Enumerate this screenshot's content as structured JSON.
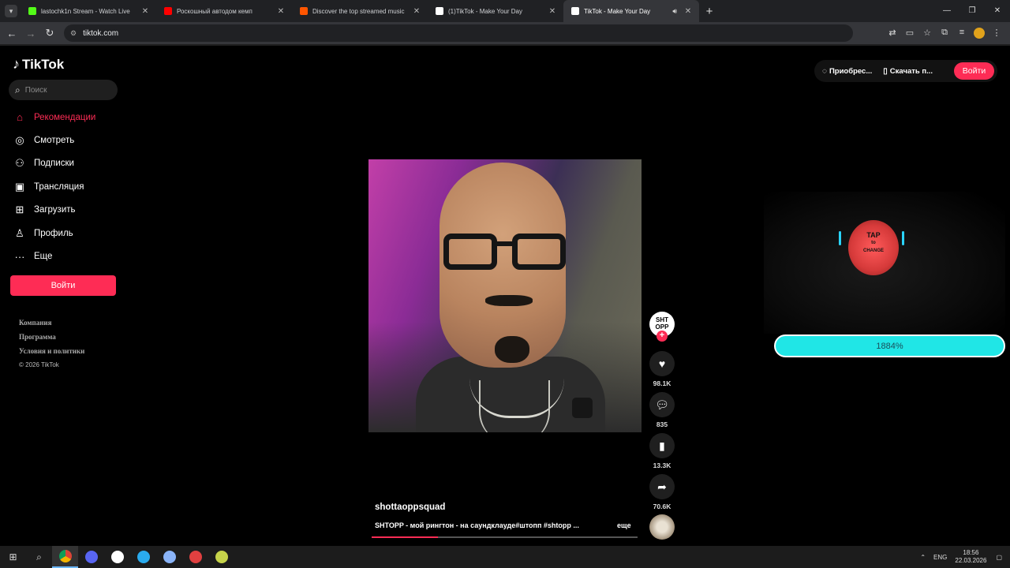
{
  "browser": {
    "tabs": [
      {
        "title": "lastochk1n Stream - Watch Live",
        "favicon_color": "#53fc18"
      },
      {
        "title": "Роскошный автодом кемп",
        "favicon_color": "#ff0000"
      },
      {
        "title": "Discover the top streamed music",
        "favicon_color": "#ff5500"
      },
      {
        "title": "(1)TikTok - Make Your Day",
        "favicon_color": "#ffffff"
      },
      {
        "title": "TikTok - Make Your Day",
        "favicon_color": "#ffffff",
        "active": true
      }
    ],
    "url": "tiktok.com"
  },
  "sidebar": {
    "logo": "TikTok",
    "search_placeholder": "Поиск",
    "nav": [
      {
        "label": "Рекомендации",
        "icon": "home-icon",
        "active": true
      },
      {
        "label": "Смотреть",
        "icon": "compass-icon"
      },
      {
        "label": "Подписки",
        "icon": "following-icon"
      },
      {
        "label": "Трансляция",
        "icon": "live-icon"
      },
      {
        "label": "Загрузить",
        "icon": "upload-icon"
      },
      {
        "label": "Профиль",
        "icon": "profile-icon"
      },
      {
        "label": "Еще",
        "icon": "more-icon"
      }
    ],
    "login_button": "Войти",
    "footer": {
      "company": "Компания",
      "program": "Программа",
      "terms": "Условия и политики",
      "copyright": "© 2026 TikTok"
    }
  },
  "header": {
    "get_coins": "Приобрес...",
    "download_app": "Скачать п...",
    "login": "Войти"
  },
  "video": {
    "creator": "shottaoppsquad",
    "description": "SHTOPP - мой рингтон - на саундклауде#штопп #shtopp ...",
    "more_label": "еще",
    "progress_fraction": 0.25,
    "avatar_text": "SHT OPP",
    "likes": "98.1K",
    "comments": "835",
    "saves": "13.3K",
    "shares": "70.6K"
  },
  "overlay": {
    "face_text_main": "TAP",
    "face_text_sub": "to",
    "face_text_end": "CHANGE",
    "progress_label": "1884%"
  },
  "taskbar": {
    "language": "ENG",
    "time": "18:56",
    "date": "22.03.2026"
  },
  "colors": {
    "accent": "#fe2c55",
    "overlay_bar": "#20e6e6"
  }
}
